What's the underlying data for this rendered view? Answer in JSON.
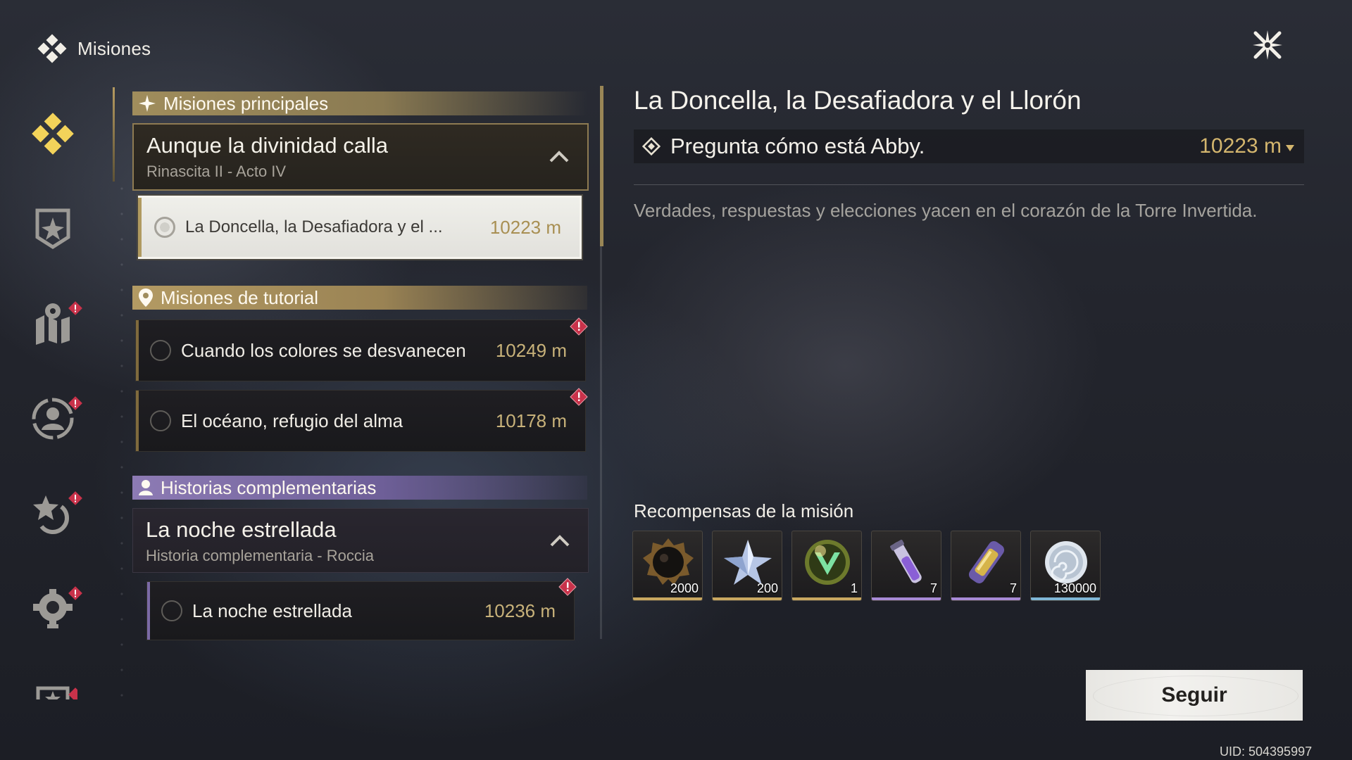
{
  "header": {
    "title": "Misiones",
    "icon": "quest-diamond-icon",
    "close_icon": "close-star-icon"
  },
  "sidebar": {
    "items": [
      {
        "name": "all-quests",
        "icon": "quest-diamond-icon",
        "active": true,
        "alert": false
      },
      {
        "name": "main-quests",
        "icon": "shield-star-icon",
        "active": false,
        "alert": false
      },
      {
        "name": "exploration-quests",
        "icon": "map-pin-icon",
        "active": false,
        "alert": true
      },
      {
        "name": "companion-quests",
        "icon": "person-circle-icon",
        "active": false,
        "alert": true
      },
      {
        "name": "daily-quests",
        "icon": "star-refresh-icon",
        "active": false,
        "alert": true
      },
      {
        "name": "system-quests",
        "icon": "gear-icon",
        "active": false,
        "alert": true
      },
      {
        "name": "event-quests",
        "icon": "star-frame-icon",
        "active": false,
        "alert": true
      }
    ]
  },
  "quest_list": {
    "main": {
      "category_label": "Misiones principales",
      "group_title": "Aunque la divinidad calla",
      "group_subtitle": "Rinascita II - Acto IV",
      "quests": [
        {
          "name": "La Doncella, la Desafiadora y el ...",
          "distance": "10223 m",
          "selected": true
        }
      ]
    },
    "tutorial": {
      "category_label": "Misiones de tutorial",
      "quests": [
        {
          "name": "Cuando los colores se desvanecen",
          "distance": "10249 m",
          "alert": true
        },
        {
          "name": "El océano, refugio del alma",
          "distance": "10178 m",
          "alert": true
        }
      ]
    },
    "side": {
      "category_label": "Historias complementarias",
      "group_title": "La noche estrellada",
      "group_subtitle": "Historia complementaria - Roccia",
      "quests": [
        {
          "name": "La noche estrellada",
          "distance": "10236 m",
          "alert": true
        }
      ]
    }
  },
  "detail": {
    "title": "La Doncella, la Desafiadora y el Llorón",
    "objective": "Pregunta cómo está Abby.",
    "objective_distance": "10223 m",
    "description": "Verdades, respuestas y elecciones yacen en el corazón de la Torre Invertida.",
    "rewards_title": "Recompensas de la misión",
    "rewards": [
      {
        "icon": "dark-orb-icon",
        "count": "2000",
        "rarity_color": "#c9a860"
      },
      {
        "icon": "crystal-star-icon",
        "count": "200",
        "rarity_color": "#c9a860"
      },
      {
        "icon": "green-emblem-icon",
        "count": "1",
        "rarity_color": "#c9a860"
      },
      {
        "icon": "purple-vial-icon",
        "count": "7",
        "rarity_color": "#a88ad6"
      },
      {
        "icon": "gold-capsule-icon",
        "count": "7",
        "rarity_color": "#a88ad6"
      },
      {
        "icon": "silver-shell-coin-icon",
        "count": "130000",
        "rarity_color": "#7fb6d6"
      }
    ],
    "follow_label": "Seguir"
  },
  "footer": {
    "uid": "UID: 504395997"
  },
  "colors": {
    "accent_gold": "#c8b27a",
    "alert_red": "#c8324a",
    "side_purple": "#8d7bb4"
  }
}
